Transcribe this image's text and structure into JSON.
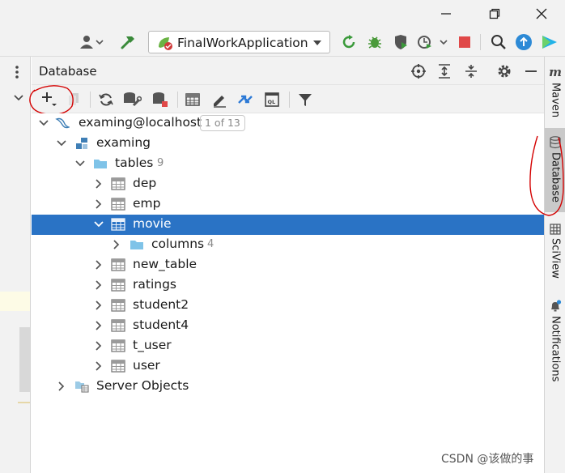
{
  "toolbar": {
    "run_config": "FinalWorkApplication"
  },
  "db_panel": {
    "title": "Database"
  },
  "tree": {
    "connection": {
      "label": "examing@localhost",
      "badge": "1 of 13"
    },
    "schema": {
      "label": "examing"
    },
    "tables_folder": {
      "label": "tables",
      "count": "9"
    },
    "tables": [
      {
        "label": "dep",
        "expanded": false
      },
      {
        "label": "emp",
        "expanded": false
      },
      {
        "label": "movie",
        "expanded": true,
        "selected": true
      },
      {
        "label": "new_table",
        "expanded": false
      },
      {
        "label": "ratings",
        "expanded": false
      },
      {
        "label": "student2",
        "expanded": false
      },
      {
        "label": "student4",
        "expanded": false
      },
      {
        "label": "t_user",
        "expanded": false
      },
      {
        "label": "user",
        "expanded": false
      }
    ],
    "columns_folder": {
      "label": "columns",
      "count": "4"
    },
    "server_objects": {
      "label": "Server Objects"
    }
  },
  "right_tabs": {
    "maven": "Maven",
    "database": "Database",
    "sciview": "SciView",
    "notifications": "Notifications"
  },
  "watermark": "CSDN @该做的事",
  "colors": {
    "selection": "#2a73c5",
    "folder": "#7fc3e8",
    "annotation": "#d40000"
  }
}
